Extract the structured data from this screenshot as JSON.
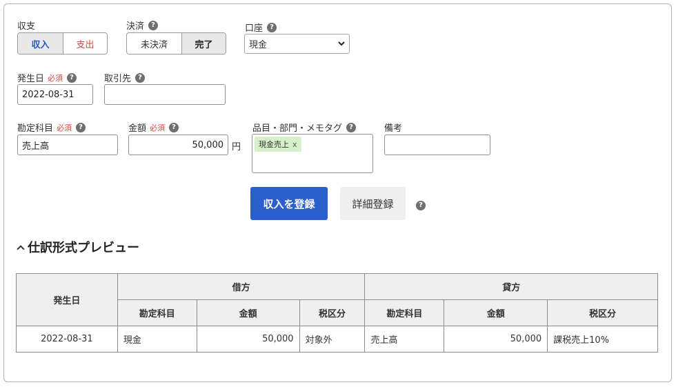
{
  "form": {
    "shushi": {
      "label": "収支",
      "options": [
        "収入",
        "支出"
      ]
    },
    "kessai": {
      "label": "決済",
      "options": [
        "未決済",
        "完了"
      ]
    },
    "koza": {
      "label": "口座",
      "value": "現金"
    },
    "hasseibi": {
      "label": "発生日",
      "required": "必須",
      "value": "2022-08-31"
    },
    "torihikisaki": {
      "label": "取引先",
      "value": ""
    },
    "kanjo": {
      "label": "勘定科目",
      "required": "必須",
      "value": "売上高"
    },
    "kingaku": {
      "label": "金額",
      "required": "必須",
      "value": "50,000",
      "unit": "円"
    },
    "hinmoku": {
      "label": "品目・部門・メモタグ",
      "tag": "現金売上",
      "tag_remove": "x"
    },
    "biko": {
      "label": "備考",
      "value": ""
    },
    "submit_label": "収入を登録",
    "detail_label": "詳細登録",
    "help_glyph": "?"
  },
  "preview": {
    "title": "仕訳形式プレビュー",
    "headers": {
      "date": "発生日",
      "debit": "借方",
      "credit": "貸方",
      "account": "勘定科目",
      "amount": "金額",
      "tax": "税区分"
    },
    "row": {
      "date": "2022-08-31",
      "debit_account": "現金",
      "debit_amount": "50,000",
      "debit_tax": "対象外",
      "credit_account": "売上高",
      "credit_amount": "50,000",
      "credit_tax": "課税売上10%"
    }
  },
  "colors": {
    "primary": "#2a5fcc",
    "required": "#d0493e",
    "tag": "#d6f0c9"
  }
}
